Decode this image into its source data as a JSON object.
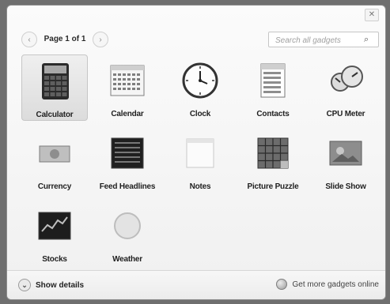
{
  "pager": {
    "prev_icon": "chevron-left-icon",
    "label": "Page 1 of 1",
    "next_icon": "chevron-right-icon"
  },
  "search": {
    "placeholder": "Search all gadgets",
    "icon": "search-icon"
  },
  "close": {
    "icon": "close-icon",
    "symbol": "✕"
  },
  "gadgets": [
    {
      "label": "Calculator",
      "selected": true
    },
    {
      "label": "Calendar"
    },
    {
      "label": "Clock"
    },
    {
      "label": "Contacts"
    },
    {
      "label": "CPU Meter"
    },
    {
      "label": "Currency"
    },
    {
      "label": "Feed Headlines"
    },
    {
      "label": "Notes"
    },
    {
      "label": "Picture Puzzle"
    },
    {
      "label": "Slide Show"
    },
    {
      "label": "Stocks"
    },
    {
      "label": "Weather"
    }
  ],
  "footer": {
    "show_details": "Show details",
    "get_more": "Get more gadgets online"
  }
}
